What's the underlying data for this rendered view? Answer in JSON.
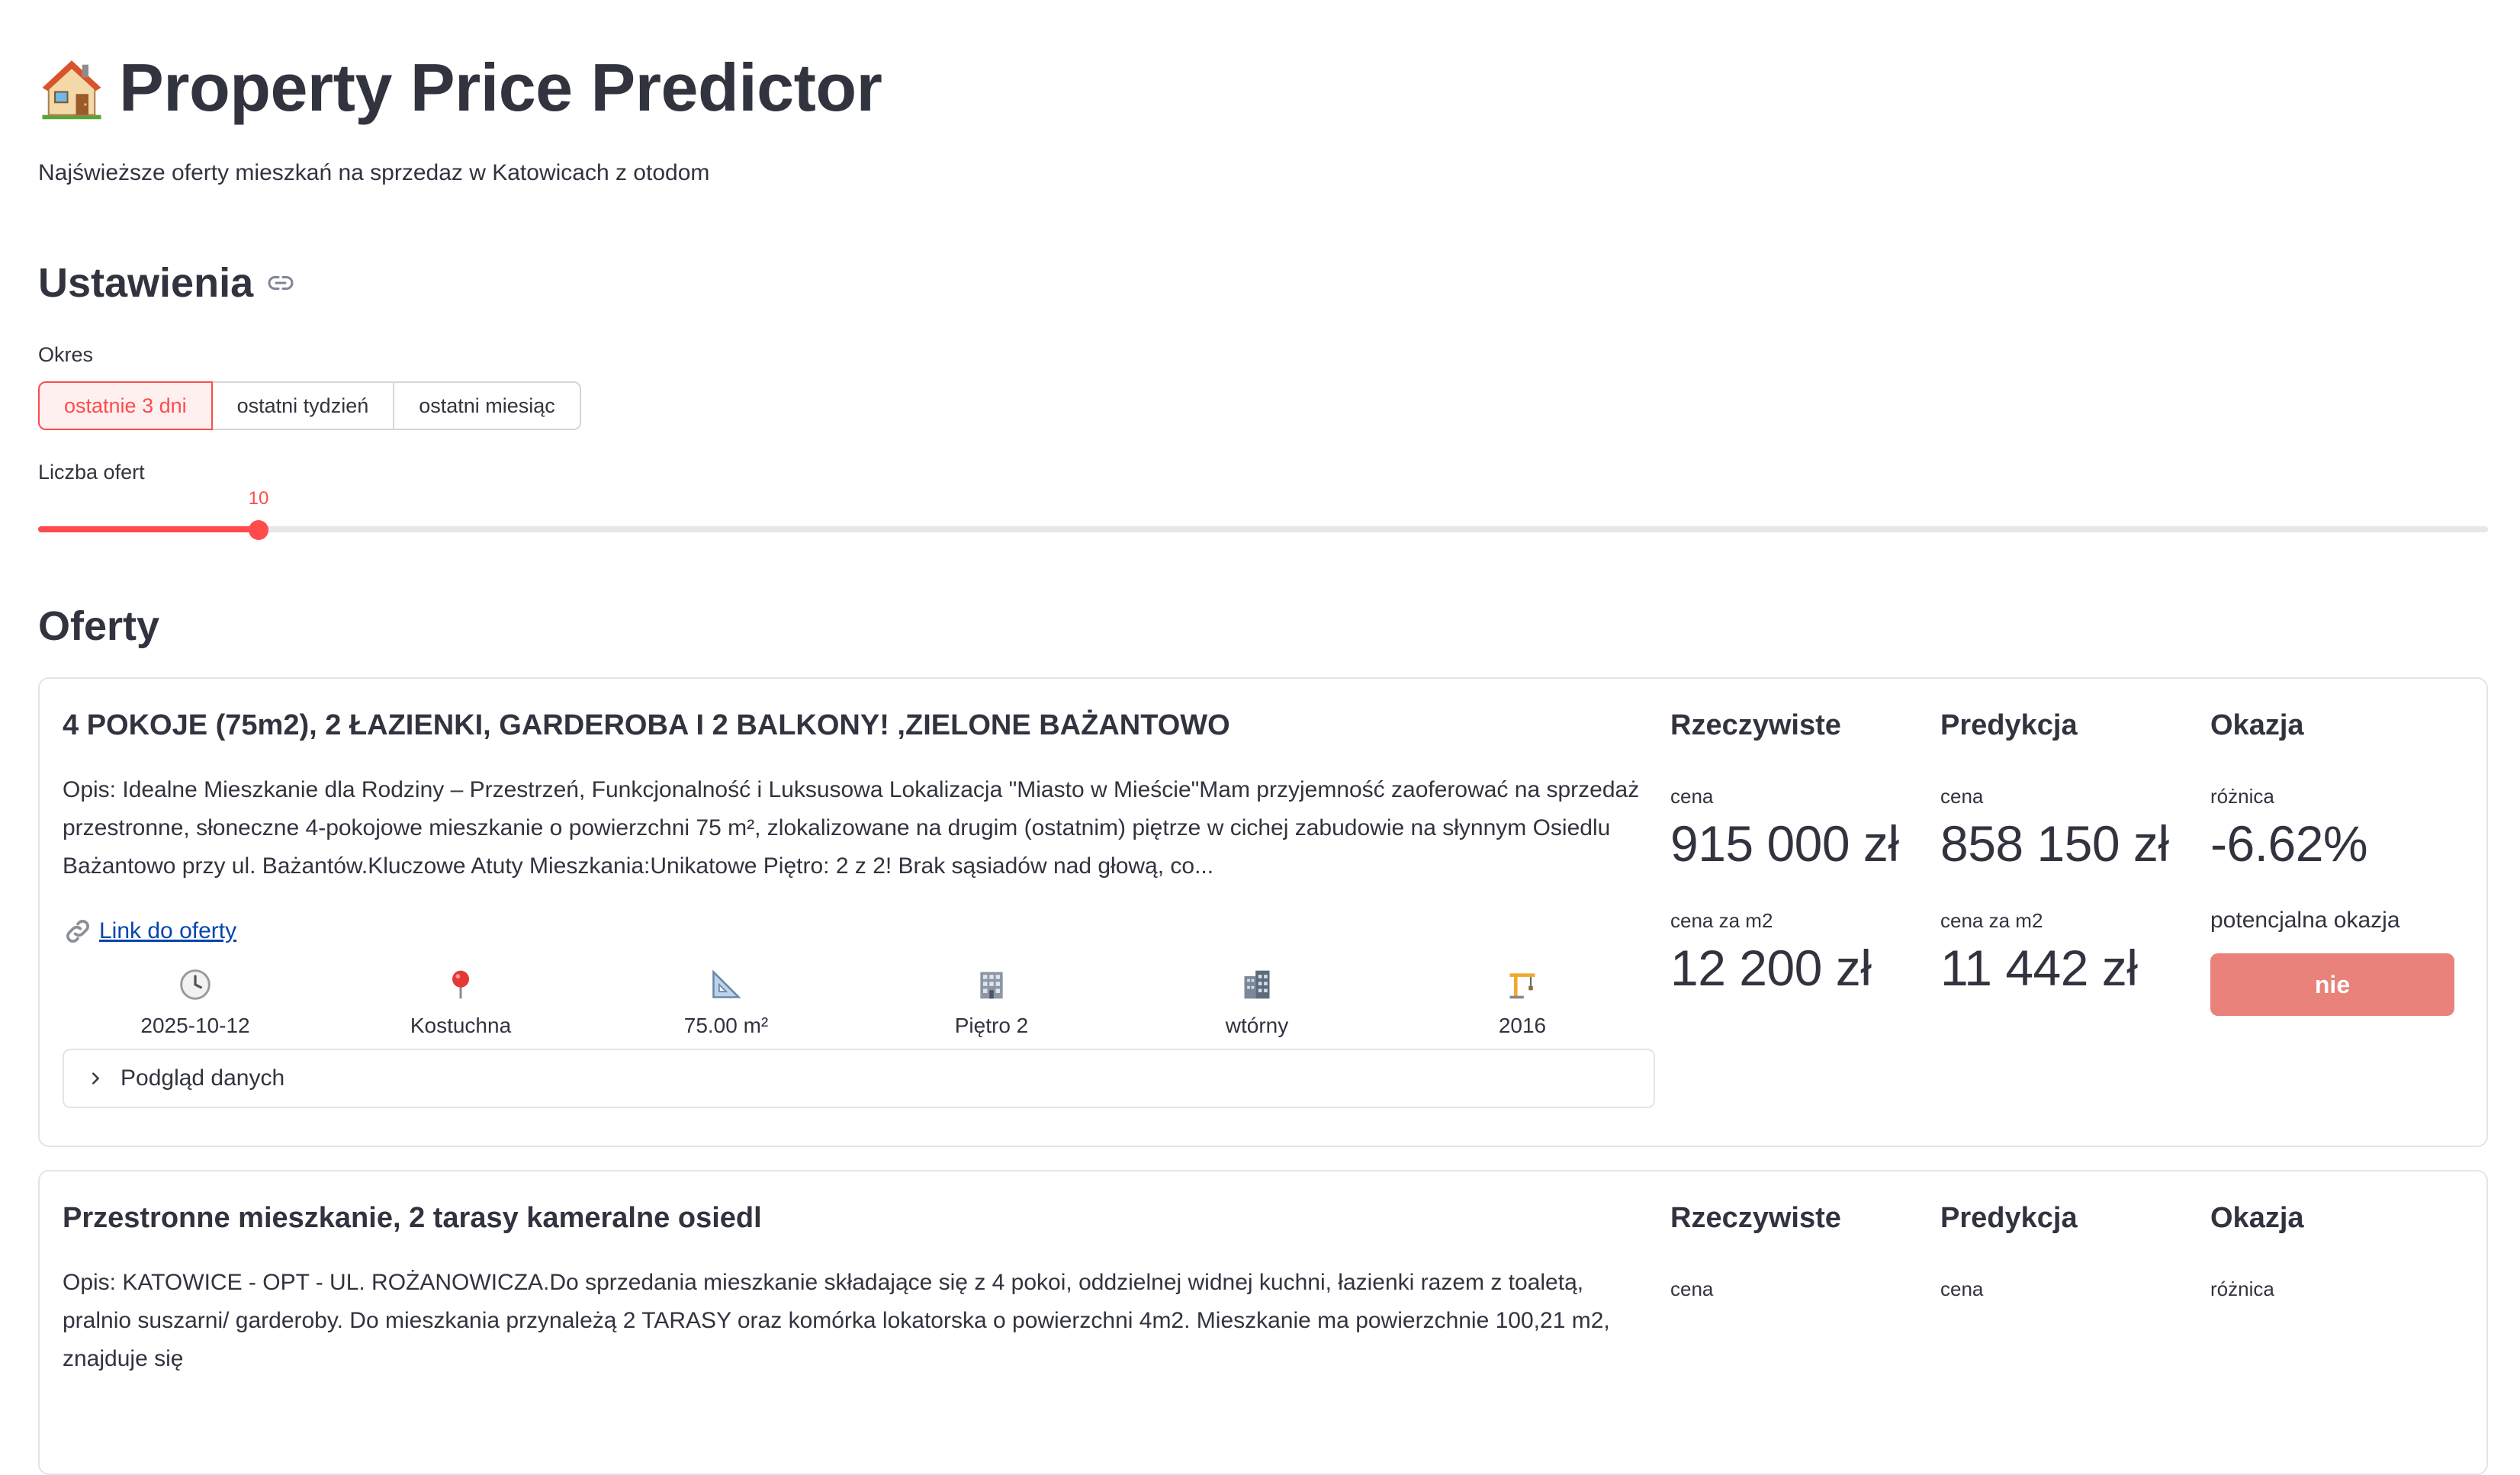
{
  "header": {
    "title": "Property Price Predictor",
    "subtitle": "Najświeższe oferty mieszkań na sprzedaz w Katowicach z otodom"
  },
  "settings": {
    "heading": "Ustawienia",
    "period_label": "Okres",
    "period_options": [
      "ostatnie 3 dni",
      "ostatni tydzień",
      "ostatni miesiąc"
    ],
    "period_selected": "ostatnie 3 dni",
    "count_label": "Liczba ofert",
    "count_value": "10",
    "count_fraction": 0.09
  },
  "offers_heading": "Oferty",
  "offers": [
    {
      "title": "4 POKOJE (75m2), 2 ŁAZIENKI, GARDEROBA I 2 BALKONY! ,ZIELONE BAŻANTOWO",
      "description": "Opis: Idealne Mieszkanie dla Rodziny – Przestrzeń, Funkcjonalność i Luksusowa Lokalizacja \"Miasto w Mieście\"Mam przyjemność zaoferować na sprzedaż przestronne, słoneczne 4-pokojowe mieszkanie o powierzchni 75 m², zlokalizowane na drugim (ostatnim) piętrze w cichej zabudowie na słynnym Osiedlu Bażantowo przy ul. Bażantów.Kluczowe Atuty Mieszkania:Unikatowe Piętro: 2 z 2! Brak sąsiadów nad głową, co...",
      "link_text": "Link do oferty",
      "date": "2025-10-12",
      "district": "Kostuchna",
      "area": "75.00 m²",
      "floor": "Piętro 2",
      "market": "wtórny",
      "year": "2016",
      "expander": "Podgląd danych",
      "actual_heading": "Rzeczywiste",
      "pred_heading": "Predykcja",
      "deal_heading": "Okazja",
      "price_label": "cena",
      "diff_label": "różnica",
      "ppm_label": "cena za m2",
      "actual_price": "915 000 zł",
      "pred_price": "858 150 zł",
      "diff": "-6.62%",
      "actual_ppm": "12 200 zł",
      "pred_ppm": "11 442 zł",
      "deal_label": "potencjalna okazja",
      "deal_value": "nie"
    },
    {
      "title": "Przestronne mieszkanie, 2 tarasy kameralne osiedl",
      "description": "Opis: KATOWICE - OPT - UL. ROŻANOWICZA.Do sprzedania mieszkanie składające się z 4 pokoi, oddzielnej widnej kuchni, łazienki razem z toaletą, pralnio suszarni/ garderoby. Do mieszkania przynależą 2 TARASY oraz komórka lokatorska o powierzchni 4m2. Mieszkanie ma powierzchnie 100,21 m2, znajduje się",
      "actual_heading": "Rzeczywiste",
      "pred_heading": "Predykcja",
      "deal_heading": "Okazja",
      "price_label": "cena",
      "diff_label": "różnica"
    }
  ],
  "colors": {
    "accent": "#ff4b4b",
    "deal_no": "#e8827a",
    "link": "#0645ad"
  }
}
